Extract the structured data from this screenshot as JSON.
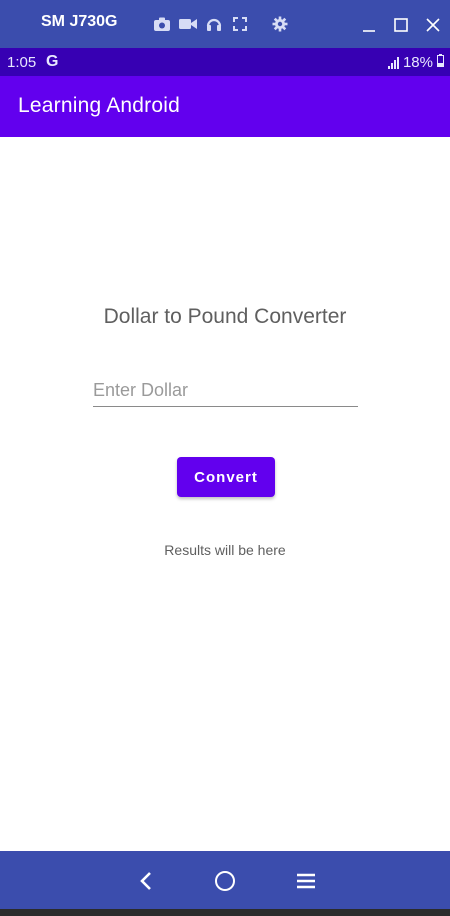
{
  "window": {
    "device_name": "SM J730G",
    "tool_icons": [
      "camera-icon",
      "video-icon",
      "headphones-icon",
      "fullscreen-icon",
      "gear-icon"
    ],
    "controls": [
      "minimize-icon",
      "maximize-icon",
      "close-icon"
    ]
  },
  "status": {
    "time": "1:05",
    "g_label": "G",
    "battery": "18%"
  },
  "app": {
    "title": "Learning Android"
  },
  "main": {
    "heading": "Dollar to Pound Converter",
    "input_placeholder": "Enter Dollar",
    "input_value": "",
    "convert_label": "Convert",
    "results_text": "Results will be here"
  },
  "nav": {
    "buttons": [
      "back-icon",
      "home-icon",
      "menu-icon"
    ]
  },
  "colors": {
    "window_bar": "#3b4dad",
    "status_bar": "#3700b3",
    "primary": "#6200ee"
  }
}
